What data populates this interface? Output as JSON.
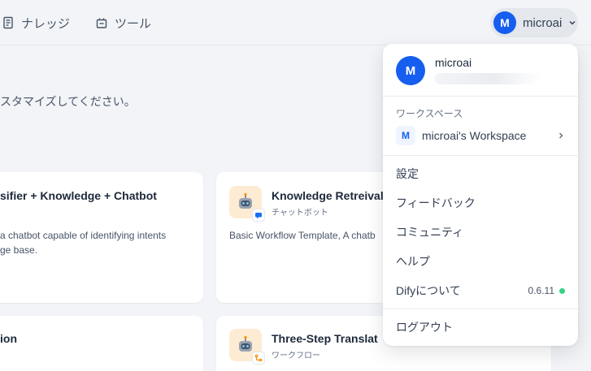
{
  "nav": {
    "knowledge": "ナレッジ",
    "tools": "ツール"
  },
  "account": {
    "avatar_initial": "M",
    "name": "microai"
  },
  "main": {
    "subtitle": "スタマイズしてください。",
    "cards": [
      {
        "title": "sifier + Knowledge + Chatbot",
        "type": "",
        "description_lines": [
          "a chatbot capable of identifying intents",
          "ge base."
        ]
      },
      {
        "title": "Knowledge Retreival",
        "type": "チャットボット",
        "description": "Basic Workflow Template, A chatb"
      },
      {
        "title": "ion",
        "type": "",
        "description": ""
      },
      {
        "title": "Three-Step Translat",
        "type": "ワークフロー",
        "description": ""
      }
    ]
  },
  "dropdown": {
    "user": {
      "avatar_initial": "M",
      "name": "microai"
    },
    "workspace_section_label": "ワークスペース",
    "workspace": {
      "icon_initial": "M",
      "name": "microai's Workspace"
    },
    "items": {
      "settings": "設定",
      "feedback": "フィードバック",
      "community": "コミュニティ",
      "help": "ヘルプ",
      "about": "Difyについて",
      "logout": "ログアウト"
    },
    "version": "0.6.11"
  },
  "colors": {
    "accent": "#155eef",
    "status_ok": "#32d583",
    "app_icon_bg": "#fdebd3"
  }
}
